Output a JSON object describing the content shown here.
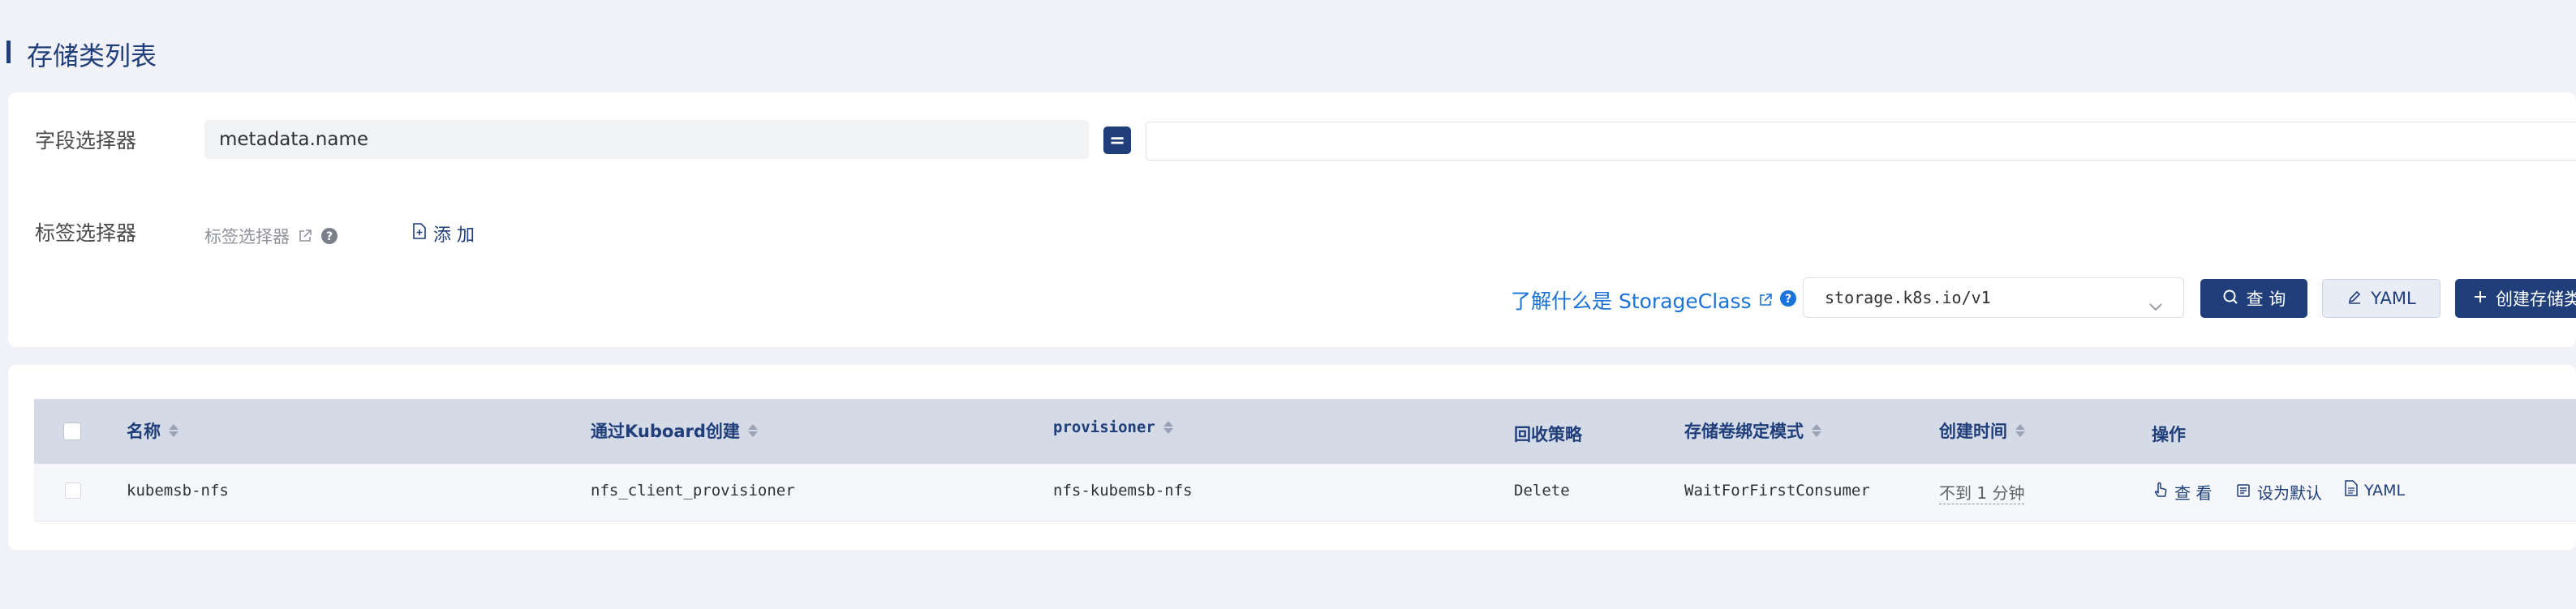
{
  "page": {
    "title": "存储类列表"
  },
  "filters": {
    "field_selector_label": "字段选择器",
    "field_value": "metadata.name",
    "operator": "=",
    "operand_value": "",
    "label_selector_label": "标签选择器",
    "label_selector_placeholder": "标签选择器",
    "add_label": "添 加"
  },
  "toolbar": {
    "learn_link": "了解什么是 StorageClass",
    "api_version": "storage.k8s.io/v1",
    "query_label": "查 询",
    "yaml_label": "YAML",
    "create_label": "创建存储类"
  },
  "table": {
    "columns": [
      "名称",
      "通过Kuboard创建",
      "provisioner",
      "回收策略",
      "存储卷绑定模式",
      "创建时间",
      "操作"
    ],
    "rows": [
      {
        "name": "kubemsb-nfs",
        "created_by": "nfs_client_provisioner",
        "provisioner": "nfs-kubemsb-nfs",
        "reclaim_policy": "Delete",
        "binding_mode": "WaitForFirstConsumer",
        "created_time": "不到 1 分钟",
        "actions": {
          "view": "查 看",
          "set_default": "设为默认",
          "yaml": "YAML"
        }
      }
    ]
  },
  "colors": {
    "primary": "#1f3e7a",
    "link": "#1a73d9",
    "page_bg": "#f0f2f8",
    "header_bg": "#d4dae6"
  },
  "icons": [
    "external-link-icon",
    "help-icon",
    "add-file-icon",
    "chevron-down-icon",
    "search-icon",
    "edit-icon",
    "plus-icon",
    "hand-icon",
    "default-icon",
    "file-icon"
  ]
}
